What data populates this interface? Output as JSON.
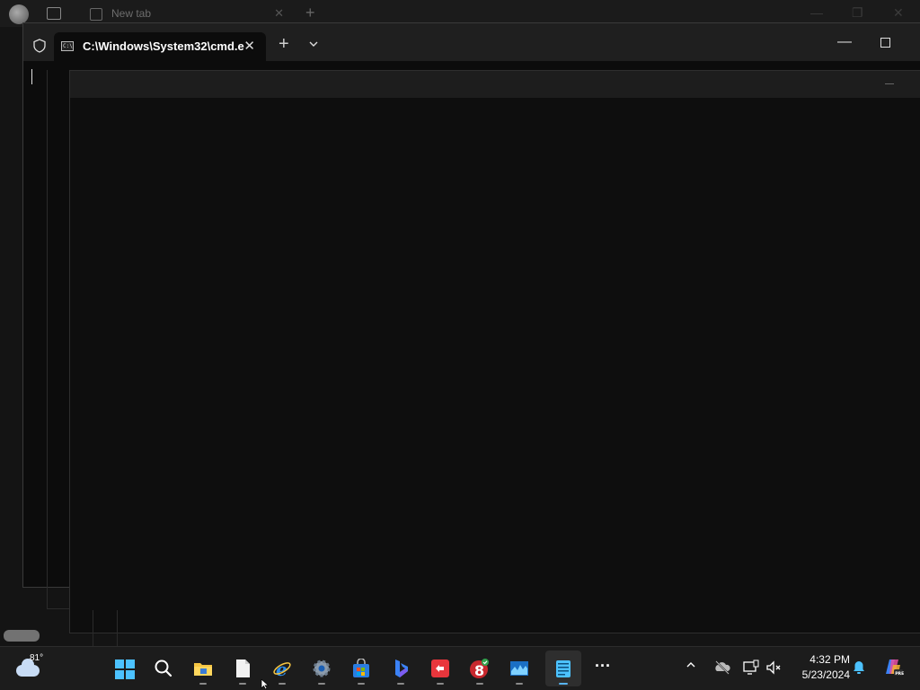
{
  "edge": {
    "tab_title": "New tab",
    "tab_close": "✕",
    "new_tab": "+",
    "ctrl_minimize": "—",
    "ctrl_restore": "❐",
    "ctrl_close": "✕"
  },
  "terminal": {
    "tab_title": "C:\\Windows\\System32\\cmd.e",
    "cmd_icon_text": "C:\\",
    "tab_close": "✕",
    "new_tab": "+",
    "minimize": "—"
  },
  "taskbar": {
    "weather_temp": "81°",
    "apps": [
      {
        "name": "start",
        "running": false
      },
      {
        "name": "search",
        "running": false
      },
      {
        "name": "file-explorer",
        "running": true
      },
      {
        "name": "notepad-file",
        "running": true
      },
      {
        "name": "internet-explorer",
        "running": true
      },
      {
        "name": "settings",
        "running": true
      },
      {
        "name": "microsoft-store",
        "running": true
      },
      {
        "name": "bing",
        "running": true
      },
      {
        "name": "remote-app",
        "running": true
      },
      {
        "name": "app-8",
        "running": true
      },
      {
        "name": "monitor-app",
        "running": true
      },
      {
        "name": "notepad",
        "running": true,
        "active": true
      }
    ],
    "more_label": "···"
  },
  "tray": {
    "time": "4:32 PM",
    "date": "5/23/2024"
  },
  "colors": {
    "accent": "#4cc2ff",
    "taskbar_bg": "#1c1c1c",
    "terminal_bg": "#0c0c0c"
  }
}
